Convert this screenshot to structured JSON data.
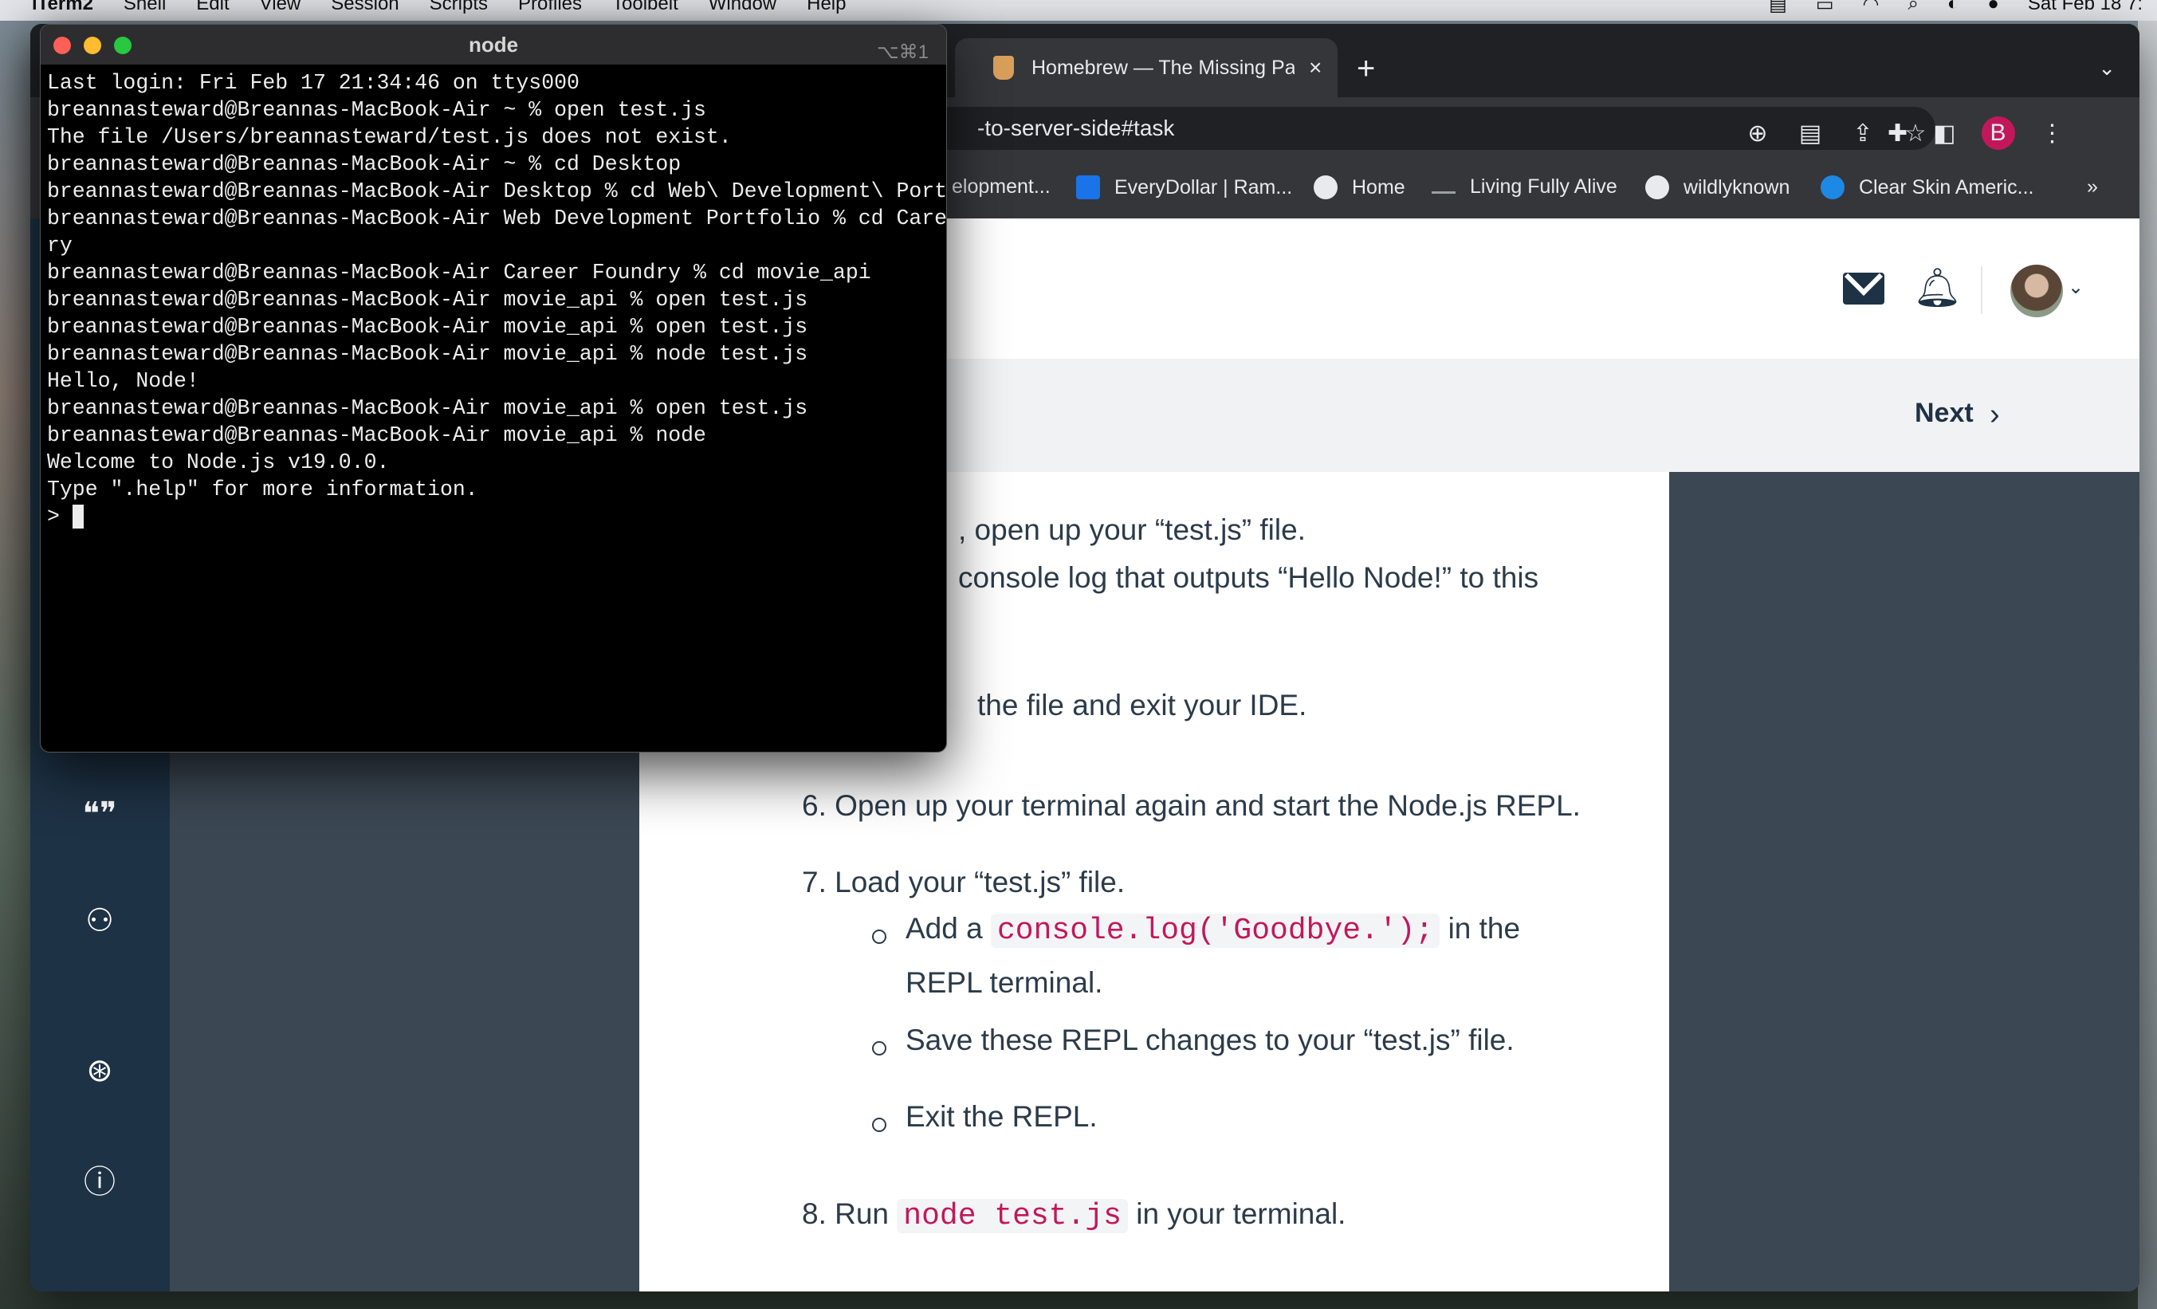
{
  "menubar": {
    "app": "iTerm2",
    "items": [
      "Shell",
      "Edit",
      "View",
      "Session",
      "Scripts",
      "Profiles",
      "Toolbelt",
      "Window",
      "Help"
    ],
    "clock": "Sat Feb 18 7:"
  },
  "browser": {
    "tab": {
      "title": "Homebrew — The Missing Pack",
      "close": "×"
    },
    "newtab": "+",
    "tab_menu": "⌄",
    "url": "-to-server-side#task",
    "profile_initial": "B",
    "bookmarks": [
      {
        "label": "elopment...",
        "color": "#35363a"
      },
      {
        "label": "EveryDollar | Ram...",
        "color": "#1a73e8"
      },
      {
        "label": "Home",
        "color": "#e8eaed"
      },
      {
        "label": "Living Fully Alive",
        "color": "#35363a"
      },
      {
        "label": "wildlyknown",
        "color": "#e8eaed"
      },
      {
        "label": "Clear Skin Americ...",
        "color": "#1e88e5"
      }
    ],
    "more_bookmarks": "»"
  },
  "page": {
    "next_label": "Next",
    "article": {
      "l1": ", open up your “test.js” file.",
      "l2": " console log that outputs “Hello Node!” to this",
      "l3": "the file and exit your IDE.",
      "step6": "6. Open up your terminal again and start the Node.js REPL.",
      "step7": "7. Load your “test.js” file.",
      "b1_pre": "Add a",
      "b1_code": "console.log('Goodbye.');",
      "b1_post": "in the",
      "b1_line2": "REPL terminal.",
      "b2": "Save these REPL changes to your “test.js” file.",
      "b3": "Exit the REPL.",
      "step8_pre": "8. Run",
      "step8_code": "node test.js",
      "step8_post": "in your terminal."
    }
  },
  "terminal": {
    "title": "node",
    "shortcut": "⌥⌘1",
    "lines": [
      "Last login: Fri Feb 17 21:34:46 on ttys000",
      "breannasteward@Breannas-MacBook-Air ~ % open test.js",
      "The file /Users/breannasteward/test.js does not exist.",
      "breannasteward@Breannas-MacBook-Air ~ % cd Desktop",
      "breannasteward@Breannas-MacBook-Air Desktop % cd Web\\ Development\\ Portfolio",
      "breannasteward@Breannas-MacBook-Air Web Development Portfolio % cd Career\\ Found",
      "ry",
      "breannasteward@Breannas-MacBook-Air Career Foundry % cd movie_api",
      "breannasteward@Breannas-MacBook-Air movie_api % open test.js",
      "breannasteward@Breannas-MacBook-Air movie_api % open test.js",
      "breannasteward@Breannas-MacBook-Air movie_api % node test.js",
      "Hello, Node!",
      "breannasteward@Breannas-MacBook-Air movie_api % open test.js",
      "breannasteward@Breannas-MacBook-Air movie_api % node",
      "Welcome to Node.js v19.0.0.",
      "Type \".help\" for more information."
    ],
    "prompt": "> "
  },
  "colors": {
    "sidebar": "#1e3245",
    "code_text": "#c2185b",
    "article_text": "#2c3b4a"
  }
}
